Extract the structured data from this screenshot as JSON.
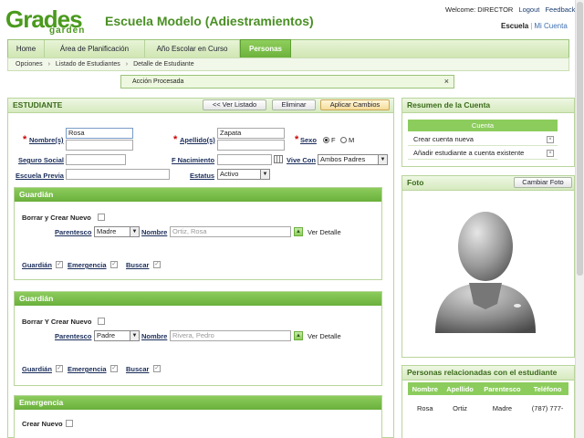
{
  "header": {
    "logo_top": "Grades",
    "logo_bottom": "garden",
    "school_title": "Escuela Modelo (Adiestramientos)",
    "welcome": "Welcome: DIRECTOR",
    "logout": "Logout",
    "feedback": "Feedback",
    "school_link": "Escuela",
    "account_link": "Mi Cuenta"
  },
  "nav": {
    "tabs": [
      "Home",
      "Área de Planificación",
      "Año Escolar en Curso",
      "Personas"
    ],
    "active": "Personas"
  },
  "breadcrumb": [
    "Opciones",
    "Listado de Estudiantes",
    "Detalle de Estudiante"
  ],
  "alert": {
    "message": "Acción Procesada",
    "close": "×"
  },
  "student": {
    "title": "ESTUDIANTE",
    "back_button": "<< Ver Listado",
    "delete_button": "Eliminar",
    "apply_button": "Aplicar Cambios",
    "labels": {
      "first_name": "Nombre(s)",
      "last_name": "Apellido(s)",
      "sex": "Sexo",
      "ssn": "Seguro Social",
      "birth_date": "F Nacimiento",
      "lives_with": "Vive Con",
      "prev_school": "Escuela Previa",
      "status": "Estatus"
    },
    "values": {
      "first_name": "Rosa",
      "last_name": "Zapata",
      "sex_f": "F",
      "sex_m": "M",
      "ssn": "",
      "birth_date": "",
      "lives_with": "Ambos Padres",
      "prev_school": "",
      "status": "Activo"
    }
  },
  "guardians": [
    {
      "title": "Guardián",
      "erase_create": "Borrar y Crear Nuevo",
      "relation_label": "Parentesco",
      "relation_value": "Madre",
      "name_label": "Nombre",
      "name_value": "Ortiz, Rosa",
      "detail": "Ver Detalle",
      "flags": [
        "Guardián",
        "Emergencia",
        "Buscar"
      ]
    },
    {
      "title": "Guardián",
      "erase_create": "Borrar Y Crear Nuevo",
      "relation_label": "Parentesco",
      "relation_value": "Padre",
      "name_label": "Nombre",
      "name_value": "Rivera, Pedro",
      "detail": "Ver Detalle",
      "flags": [
        "Guardián",
        "Emergencia",
        "Buscar"
      ]
    }
  ],
  "emergency": {
    "title": "Emergencia",
    "create": "Crear Nuevo"
  },
  "account_summary": {
    "title": "Resumen de la Cuenta",
    "sub_header": "Cuenta",
    "items": [
      "Crear cuenta nueva",
      "Añadir estudiante a cuenta existente"
    ]
  },
  "photo": {
    "title": "Foto",
    "change_button": "Cambiar Foto"
  },
  "related": {
    "title": "Personas relacionadas con el estudiante",
    "columns": [
      "Nombre",
      "Apellido",
      "Parentesco",
      "Teléfono"
    ],
    "rows": [
      [
        "Rosa",
        "Ortiz",
        "Madre",
        "(787) 777-"
      ]
    ]
  }
}
